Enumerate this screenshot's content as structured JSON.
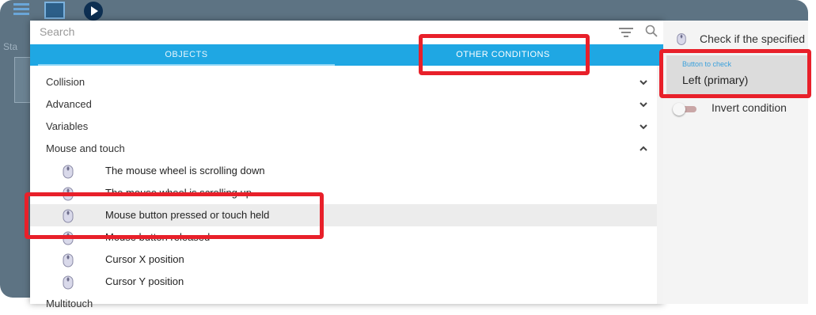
{
  "background": {
    "label": "Sta"
  },
  "search": {
    "placeholder": "Search"
  },
  "tabs": [
    {
      "label": "OBJECTS"
    },
    {
      "label": "OTHER CONDITIONS"
    }
  ],
  "categories": [
    {
      "label": "Collision",
      "expanded": false
    },
    {
      "label": "Advanced",
      "expanded": false
    },
    {
      "label": "Variables",
      "expanded": false
    },
    {
      "label": "Mouse and touch",
      "expanded": true
    }
  ],
  "mouse_items": [
    {
      "label": "The mouse wheel is scrolling down",
      "icon": "mouse-icon"
    },
    {
      "label": "The mouse wheel is scrolling up",
      "icon": "mouse-icon"
    },
    {
      "label": "Mouse button pressed or touch held",
      "icon": "mouse-icon",
      "selected": true
    },
    {
      "label": "Mouse button released",
      "icon": "mouse-icon"
    },
    {
      "label": "Cursor X position",
      "icon": "mouse-icon"
    },
    {
      "label": "Cursor Y position",
      "icon": "mouse-icon"
    }
  ],
  "partial_category": {
    "label": "Multitouch"
  },
  "right_panel": {
    "description": "Check if the specified",
    "button_field_label": "Button to check",
    "button_field_value": "Left (primary)",
    "invert_label": "Invert condition",
    "invert_on": false
  },
  "colors": {
    "tab_bar": "#1fa7e3",
    "highlight": "#e8202a",
    "selected_row": "#ececec"
  }
}
